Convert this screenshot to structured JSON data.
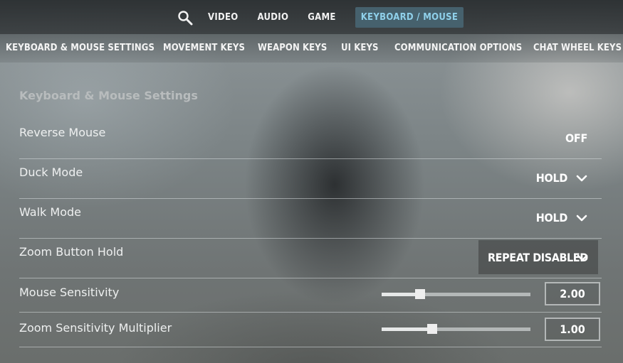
{
  "top_nav": {
    "search_icon": "search-icon",
    "tabs": [
      "VIDEO",
      "AUDIO",
      "GAME",
      "KEYBOARD / MOUSE"
    ],
    "active_tab": "KEYBOARD / MOUSE",
    "active_tab_color": "#46616d",
    "active_text_color": "#8fd0ea"
  },
  "sub_nav": {
    "items": [
      "KEYBOARD & MOUSE SETTINGS",
      "MOVEMENT KEYS",
      "WEAPON KEYS",
      "UI KEYS",
      "COMMUNICATION OPTIONS",
      "CHAT WHEEL KEYS"
    ]
  },
  "section": {
    "title": "Keyboard & Mouse Settings"
  },
  "settings": {
    "reverse_mouse": {
      "label": "Reverse Mouse",
      "value": "OFF"
    },
    "duck_mode": {
      "label": "Duck Mode",
      "value": "HOLD"
    },
    "walk_mode": {
      "label": "Walk Mode",
      "value": "HOLD"
    },
    "zoom_button_hold": {
      "label": "Zoom Button Hold",
      "value": "REPEAT DISABLED"
    },
    "mouse_sensitivity": {
      "label": "Mouse Sensitivity",
      "value": "2.00",
      "slider_fraction": 0.26
    },
    "zoom_sensitivity": {
      "label": "Zoom Sensitivity Multiplier",
      "value": "1.00",
      "slider_fraction": 0.34
    }
  }
}
